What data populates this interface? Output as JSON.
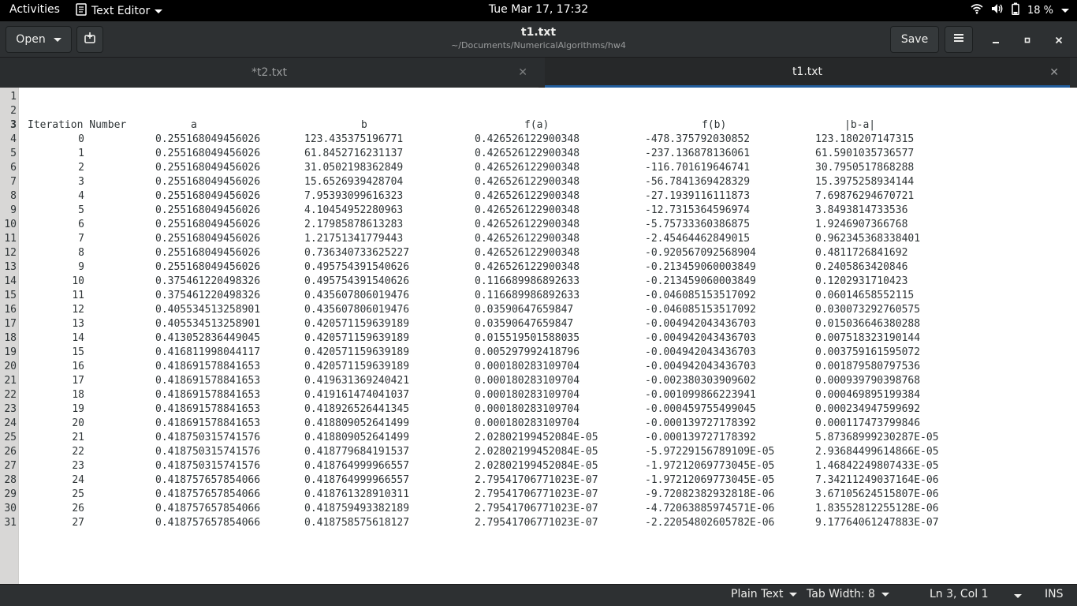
{
  "topbar": {
    "activities": "Activities",
    "app_menu": "Text Editor",
    "clock": "Tue Mar 17, 17:32",
    "battery_pct": "18 %"
  },
  "header": {
    "open_label": "Open",
    "title": "t1.txt",
    "subtitle": "~/Documents/NumericalAlgorithms/hw4",
    "save_label": "Save"
  },
  "tabs": [
    {
      "label": "*t2.txt",
      "active": false
    },
    {
      "label": "t1.txt",
      "active": true
    }
  ],
  "editor": {
    "header_line": {
      "line": 3,
      "cols": [
        "Iteration Number",
        "a",
        "b",
        "f(a)",
        "f(b)",
        "|b-a|"
      ]
    },
    "rows": [
      [
        "0",
        "0.255168049456026",
        "123.435375196771",
        "0.426526122900348",
        "-478.375792030852",
        "123.180207147315"
      ],
      [
        "1",
        "0.255168049456026",
        "61.8452716231137",
        "0.426526122900348",
        "-237.136878136061",
        "61.5901035736577"
      ],
      [
        "2",
        "0.255168049456026",
        "31.0502198362849",
        "0.426526122900348",
        "-116.701619646741",
        "30.7950517868288"
      ],
      [
        "3",
        "0.255168049456026",
        "15.6526939428704",
        "0.426526122900348",
        "-56.7841369428329",
        "15.3975258934144"
      ],
      [
        "4",
        "0.255168049456026",
        "7.95393099616323",
        "0.426526122900348",
        "-27.1939116111873",
        "7.69876294670721"
      ],
      [
        "5",
        "0.255168049456026",
        "4.10454952280963",
        "0.426526122900348",
        "-12.7315364596974",
        "3.8493814733536"
      ],
      [
        "6",
        "0.255168049456026",
        "2.17985878613283",
        "0.426526122900348",
        "-5.75733360386875",
        "1.9246907366768"
      ],
      [
        "7",
        "0.255168049456026",
        "1.21751341779443",
        "0.426526122900348",
        "-2.45464462849015",
        "0.962345368338401"
      ],
      [
        "8",
        "0.255168049456026",
        "0.736340733625227",
        "0.426526122900348",
        "-0.920567092568904",
        "0.4811726841692"
      ],
      [
        "9",
        "0.255168049456026",
        "0.495754391540626",
        "0.426526122900348",
        "-0.213459060003849",
        "0.2405863420846"
      ],
      [
        "10",
        "0.375461220498326",
        "0.495754391540626",
        "0.116689986892633",
        "-0.213459060003849",
        "0.1202931710423"
      ],
      [
        "11",
        "0.375461220498326",
        "0.435607806019476",
        "0.116689986892633",
        "-0.046085153517092",
        "0.06014658552115"
      ],
      [
        "12",
        "0.405534513258901",
        "0.435607806019476",
        "0.03590647659847",
        "-0.046085153517092",
        "0.030073292760575"
      ],
      [
        "13",
        "0.405534513258901",
        "0.420571159639189",
        "0.03590647659847",
        "-0.004942043436703",
        "0.015036646380288"
      ],
      [
        "14",
        "0.413052836449045",
        "0.420571159639189",
        "0.015519501588035",
        "-0.004942043436703",
        "0.007518323190144"
      ],
      [
        "15",
        "0.416811998044117",
        "0.420571159639189",
        "0.005297992418796",
        "-0.004942043436703",
        "0.003759161595072"
      ],
      [
        "16",
        "0.418691578841653",
        "0.420571159639189",
        "0.000180283109704",
        "-0.004942043436703",
        "0.001879580797536"
      ],
      [
        "17",
        "0.418691578841653",
        "0.419631369240421",
        "0.000180283109704",
        "-0.002380303909602",
        "0.000939790398768"
      ],
      [
        "18",
        "0.418691578841653",
        "0.419161474041037",
        "0.000180283109704",
        "-0.001099866223941",
        "0.000469895199384"
      ],
      [
        "19",
        "0.418691578841653",
        "0.418926526441345",
        "0.000180283109704",
        "-0.000459755499045",
        "0.000234947599692"
      ],
      [
        "20",
        "0.418691578841653",
        "0.418809052641499",
        "0.000180283109704",
        "-0.000139727178392",
        "0.000117473799846"
      ],
      [
        "21",
        "0.418750315741576",
        "0.418809052641499",
        "2.02802199452084E-05",
        "-0.000139727178392",
        "5.87368999230287E-05"
      ],
      [
        "22",
        "0.418750315741576",
        "0.418779684191537",
        "2.02802199452084E-05",
        "-5.97229156789109E-05",
        "2.93684499614866E-05"
      ],
      [
        "23",
        "0.418750315741576",
        "0.418764999966557",
        "2.02802199452084E-05",
        "-1.97212069773045E-05",
        "1.46842249807433E-05"
      ],
      [
        "24",
        "0.418757657854066",
        "0.418764999966557",
        "2.79541706771023E-07",
        "-1.97212069773045E-05",
        "7.34211249037164E-06"
      ],
      [
        "25",
        "0.418757657854066",
        "0.418761328910311",
        "2.79541706771023E-07",
        "-9.72082382932818E-06",
        "3.67105624515807E-06"
      ],
      [
        "26",
        "0.418757657854066",
        "0.418759493382189",
        "2.79541706771023E-07",
        "-4.72063885974571E-06",
        "1.83552812255128E-06"
      ],
      [
        "27",
        "0.418757657854066",
        "0.418758575618127",
        "2.79541706771023E-07",
        "-2.22054802605782E-06",
        "9.17764061247883E-07"
      ]
    ]
  },
  "statusbar": {
    "language": "Plain Text",
    "tab_width": "Tab Width: 8",
    "cursor_position": "Ln 3, Col 1",
    "insert_mode": "INS"
  },
  "colors": {
    "top_bar": "#000000",
    "header_bar": "#2d3032",
    "active_tab_underline": "#215d9c",
    "gutter": "#d8d7d6",
    "text": "#2e3436"
  }
}
